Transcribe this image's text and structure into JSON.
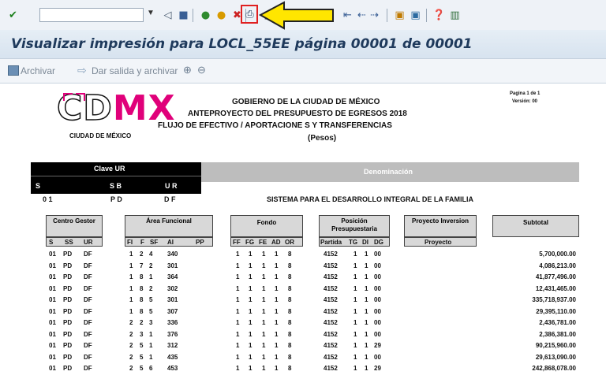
{
  "toolbar": {
    "command_value": "",
    "icons": [
      "check-icon",
      "back-icon",
      "save-icon",
      "shortcut-back-icon",
      "shortcut-exit-icon",
      "cancel-icon",
      "print-icon",
      "find-icon",
      "find-next-icon",
      "first-page-icon",
      "prev-page-icon",
      "next-page-icon",
      "last-page-icon",
      "new-session-icon",
      "shortcut-icon",
      "help-icon",
      "layout-icon"
    ]
  },
  "title": "Visualizar impresión para LOCL_55EE página 00001 de 00001",
  "subbar": {
    "archivar": "Archivar",
    "dar_salida": "Dar salida y archivar"
  },
  "report": {
    "logo": "CDMX",
    "logo_sub": "CIUDAD DE MÉXICO",
    "heading1": "GOBIERNO  DE  LA  CIUDAD  DE  MÉXICO",
    "heading2": "ANTEPROYECTO   DEL        PRESUPUESTO DE  EGRESOS  2018",
    "heading3": "FLUJO  DE  EFECTIVO  / APORTACIONE S    Y      TRANSFERENCIAS",
    "heading4": "(Pesos)",
    "pagina": "Pagina  1  de 1",
    "version": "Versión:   00",
    "clave_label": "Clave  UR",
    "denominacion_label": "Denominación",
    "s_label": "S",
    "sb_label": "S B",
    "ur_label": "U R",
    "s_val": "0 1",
    "sb_val": "P D",
    "ur_val": "D F",
    "denominacion_val": "SISTEMA   PARA   EL   DESARROLLO INTEGRAL  DE  LA  FAMILIA",
    "col_centro": "Centro Gestor",
    "col_area": "Área Funcional",
    "col_fondo": "Fondo",
    "col_posicion": "Posición Presupuestaria",
    "col_proyecto": "Proyecto Inversion",
    "col_subtotal": "Subtotal",
    "sub_centro": [
      "S",
      "SS",
      "UR"
    ],
    "sub_area": [
      "FI",
      "F",
      "SF",
      "AI",
      "PP"
    ],
    "sub_fondo": [
      "FF",
      "FG",
      "FE",
      "AD",
      "OR"
    ],
    "sub_posicion": [
      "Partida",
      "TG",
      "DI",
      "DG"
    ],
    "sub_proyecto": "Proyecto",
    "rows": [
      {
        "s": "01",
        "ss": "PD",
        "ur": "DF",
        "fi": "1",
        "f": "2",
        "sf": "4",
        "ai": "340",
        "ff": "1",
        "fg": "1",
        "fe": "1",
        "ad": "1",
        "or": "8",
        "partida": "4152",
        "tg": "1",
        "di": "1",
        "dg": "00",
        "subtotal": "5,700,000.00"
      },
      {
        "s": "01",
        "ss": "PD",
        "ur": "DF",
        "fi": "1",
        "f": "7",
        "sf": "2",
        "ai": "301",
        "ff": "1",
        "fg": "1",
        "fe": "1",
        "ad": "1",
        "or": "8",
        "partida": "4152",
        "tg": "1",
        "di": "1",
        "dg": "00",
        "subtotal": "4,086,213.00"
      },
      {
        "s": "01",
        "ss": "PD",
        "ur": "DF",
        "fi": "1",
        "f": "8",
        "sf": "1",
        "ai": "364",
        "ff": "1",
        "fg": "1",
        "fe": "1",
        "ad": "1",
        "or": "8",
        "partida": "4152",
        "tg": "1",
        "di": "1",
        "dg": "00",
        "subtotal": "41,877,496.00"
      },
      {
        "s": "01",
        "ss": "PD",
        "ur": "DF",
        "fi": "1",
        "f": "8",
        "sf": "2",
        "ai": "302",
        "ff": "1",
        "fg": "1",
        "fe": "1",
        "ad": "1",
        "or": "8",
        "partida": "4152",
        "tg": "1",
        "di": "1",
        "dg": "00",
        "subtotal": "12,431,465.00"
      },
      {
        "s": "01",
        "ss": "PD",
        "ur": "DF",
        "fi": "1",
        "f": "8",
        "sf": "5",
        "ai": "301",
        "ff": "1",
        "fg": "1",
        "fe": "1",
        "ad": "1",
        "or": "8",
        "partida": "4152",
        "tg": "1",
        "di": "1",
        "dg": "00",
        "subtotal": "335,718,937.00"
      },
      {
        "s": "01",
        "ss": "PD",
        "ur": "DF",
        "fi": "1",
        "f": "8",
        "sf": "5",
        "ai": "307",
        "ff": "1",
        "fg": "1",
        "fe": "1",
        "ad": "1",
        "or": "8",
        "partida": "4152",
        "tg": "1",
        "di": "1",
        "dg": "00",
        "subtotal": "29,395,110.00"
      },
      {
        "s": "01",
        "ss": "PD",
        "ur": "DF",
        "fi": "2",
        "f": "2",
        "sf": "3",
        "ai": "336",
        "ff": "1",
        "fg": "1",
        "fe": "1",
        "ad": "1",
        "or": "8",
        "partida": "4152",
        "tg": "1",
        "di": "1",
        "dg": "00",
        "subtotal": "2,436,781.00"
      },
      {
        "s": "01",
        "ss": "PD",
        "ur": "DF",
        "fi": "2",
        "f": "3",
        "sf": "1",
        "ai": "376",
        "ff": "1",
        "fg": "1",
        "fe": "1",
        "ad": "1",
        "or": "8",
        "partida": "4152",
        "tg": "1",
        "di": "1",
        "dg": "00",
        "subtotal": "2,386,381.00"
      },
      {
        "s": "01",
        "ss": "PD",
        "ur": "DF",
        "fi": "2",
        "f": "5",
        "sf": "1",
        "ai": "312",
        "ff": "1",
        "fg": "1",
        "fe": "1",
        "ad": "1",
        "or": "8",
        "partida": "4152",
        "tg": "1",
        "di": "1",
        "dg": "29",
        "subtotal": "90,215,960.00"
      },
      {
        "s": "01",
        "ss": "PD",
        "ur": "DF",
        "fi": "2",
        "f": "5",
        "sf": "1",
        "ai": "435",
        "ff": "1",
        "fg": "1",
        "fe": "1",
        "ad": "1",
        "or": "8",
        "partida": "4152",
        "tg": "1",
        "di": "1",
        "dg": "00",
        "subtotal": "29,613,090.00"
      },
      {
        "s": "01",
        "ss": "PD",
        "ur": "DF",
        "fi": "2",
        "f": "5",
        "sf": "6",
        "ai": "453",
        "ff": "1",
        "fg": "1",
        "fe": "1",
        "ad": "1",
        "or": "8",
        "partida": "4152",
        "tg": "1",
        "di": "1",
        "dg": "29",
        "subtotal": "242,868,078.00"
      }
    ]
  },
  "colors": {
    "logo_black": "#111111",
    "logo_magenta": "#e0007a",
    "highlight_red": "#e02020",
    "arrow_yellow": "#ffe600"
  }
}
